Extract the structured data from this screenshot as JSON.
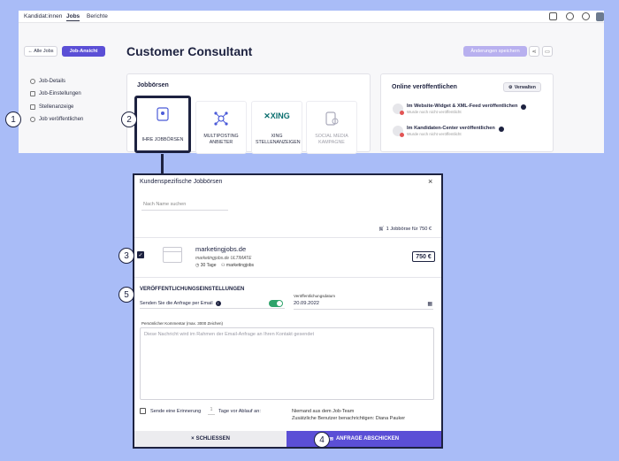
{
  "topnav": {
    "tabs": [
      "Kandidat:innen",
      "Jobs",
      "Berichte"
    ]
  },
  "header": {
    "back_label": "← Alle Jobs",
    "jobansicht_label": "Job-Ansicht",
    "job_title": "Customer Consultant",
    "save_label": "Änderungen speichern"
  },
  "sidebar": {
    "items": [
      {
        "label": "Job-Details",
        "icon": "info-icon"
      },
      {
        "label": "Job-Einstellungen",
        "icon": "wrench-icon"
      },
      {
        "label": "Stellenanzeige",
        "icon": "document-icon"
      },
      {
        "label": "Job veröffentlichen",
        "icon": "broadcast-icon"
      }
    ]
  },
  "jobboersen": {
    "title": "Jobbörsen",
    "cards": [
      {
        "label": "IHRE JOBBÖRSEN",
        "icon": "badge-icon"
      },
      {
        "label": "MULTIPOSTING ANBIETER",
        "icon": "network-icon"
      },
      {
        "label": "XING STELLENANZEIGEN",
        "icon": "xing-logo"
      },
      {
        "label": "SOCIAL MEDIA KAMPAGNE",
        "icon": "social-icon"
      }
    ]
  },
  "online": {
    "title": "Online veröffentlichen",
    "manage_label": "Verwalten",
    "rows": [
      {
        "title": "Im Website-Widget & XML-Feed veröffentlichen",
        "status": "Wurde noch nicht veröffentlicht"
      },
      {
        "title": "Im Kandidaten-Center veröffentlichen",
        "status": "Wurde noch nicht veröffentlicht"
      }
    ]
  },
  "modal": {
    "title": "Kundenspezifische Jobbörsen",
    "close_glyph": "×",
    "search_placeholder": "Nach Name suchen",
    "count_text": "1 Jobbörse für 750 €",
    "item": {
      "name": "marketingjobs.de",
      "subtitle": "marketingjobs.de ULTIMATE",
      "duration": "30 Tage",
      "provider": "marketingjobs",
      "price": "750 €",
      "checked": true
    },
    "settings": {
      "title": "VERÖFFENTLICHUNGSEINSTELLUNGEN",
      "email_label": "Senden Sie die Anfrage per Email",
      "email_toggle_on": true,
      "date_label": "Veröffentlichungsdatum",
      "date_value": "20.09.2022",
      "comment_label": "Persönlicher Kommentar (max. 3000 Zeichen)",
      "comment_placeholder": "Diese Nachricht wird im Rahmen der Email-Anfrage an Ihren Kontakt gesendet",
      "reminder_label": "Sende eine Erinnerung",
      "reminder_days": "1",
      "reminder_suffix": "Tage vor Ablauf an:",
      "notify_line1": "Niemand aus dem Job-Team",
      "notify_line2": "Zusätzliche Benutzer benachrichtigen: Diana Pauker"
    },
    "close_label": "SCHLIESSEN",
    "send_label": "ANFRAGE ABSCHICKEN"
  },
  "callouts": [
    "1",
    "2",
    "3",
    "4",
    "5"
  ],
  "colors": {
    "accent": "#5b4fd6",
    "navy": "#1d2240",
    "background": "#a9bcf7",
    "toggle_on": "#2fa36b"
  }
}
